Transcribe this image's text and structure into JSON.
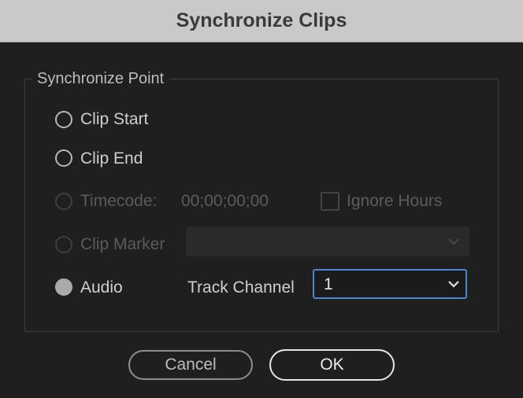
{
  "window": {
    "title": "Synchronize Clips"
  },
  "sync_point": {
    "legend": "Synchronize Point",
    "options": [
      {
        "id": "clip-start",
        "label": "Clip Start",
        "enabled": true,
        "checked": false
      },
      {
        "id": "clip-end",
        "label": "Clip End",
        "enabled": true,
        "checked": false
      },
      {
        "id": "timecode",
        "label": "Timecode:",
        "enabled": false,
        "checked": false
      },
      {
        "id": "clip-marker",
        "label": "Clip Marker",
        "enabled": false,
        "checked": false
      },
      {
        "id": "audio",
        "label": "Audio",
        "enabled": true,
        "checked": true
      }
    ],
    "timecode_value": "00;00;00;00",
    "ignore_hours_label": "Ignore Hours",
    "ignore_hours_checked": false,
    "clip_marker_selected": "",
    "track_channel_label": "Track Channel",
    "track_channel_selected": "1"
  },
  "buttons": {
    "cancel": "Cancel",
    "ok": "OK"
  },
  "colors": {
    "focus_accent": "#4a86d0",
    "dialog_bg": "#1f1f1f",
    "titlebar_bg": "#c9c9c9"
  },
  "icons": {
    "select_arrow": "chevron-down-icon"
  }
}
